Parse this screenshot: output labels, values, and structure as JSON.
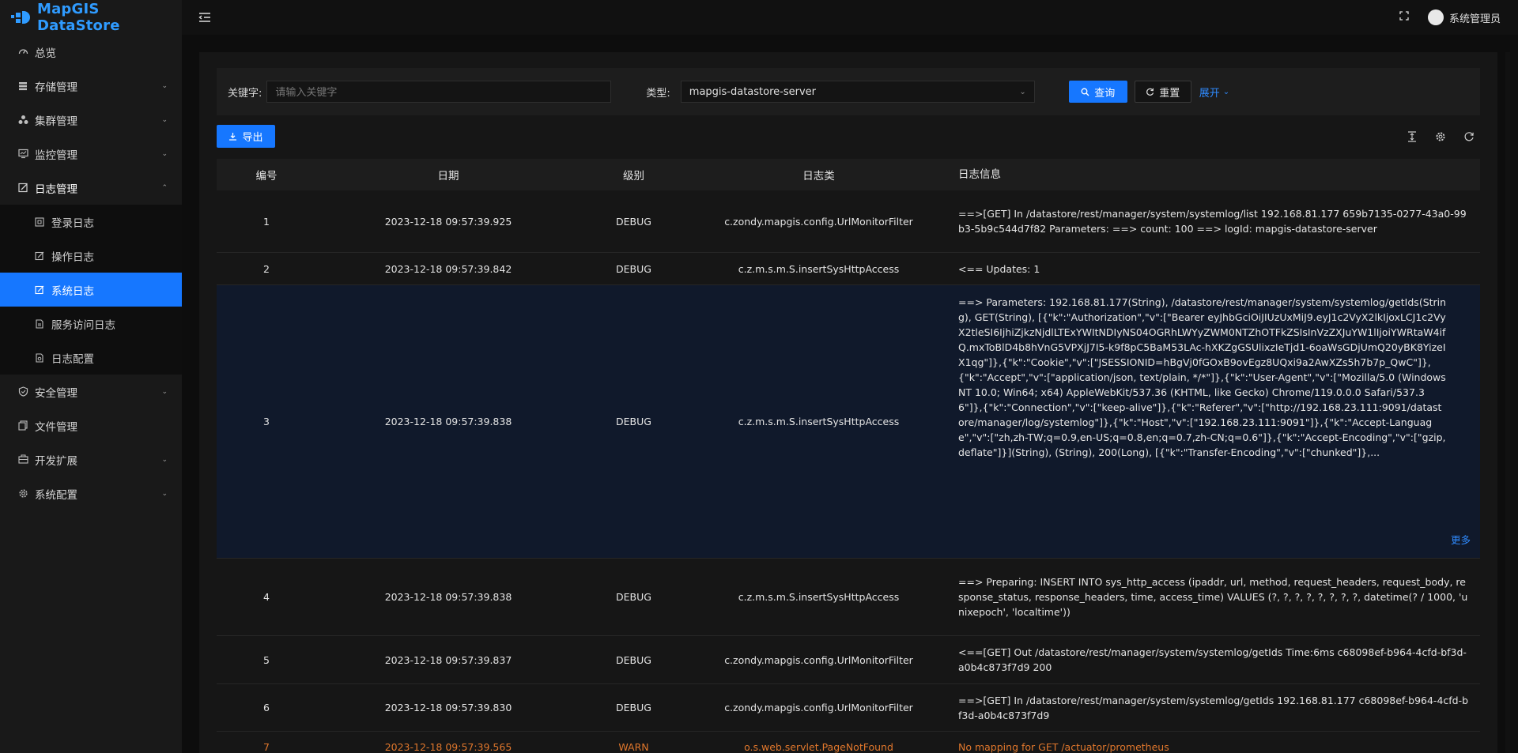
{
  "app": {
    "title": "MapGIS DataStore"
  },
  "colors": {
    "accent": "#1677ff",
    "warn": "#e0772c",
    "sidebar_bg": "#191919"
  },
  "sidebar": {
    "items": [
      {
        "label": "总览",
        "icon": "dashboard-icon",
        "has_chevron": false
      },
      {
        "label": "存储管理",
        "icon": "database-icon",
        "has_chevron": true
      },
      {
        "label": "集群管理",
        "icon": "cluster-icon",
        "has_chevron": true
      },
      {
        "label": "监控管理",
        "icon": "monitor-icon",
        "has_chevron": true
      },
      {
        "label": "日志管理",
        "icon": "log-icon",
        "has_chevron": true,
        "expanded": true,
        "children": [
          {
            "label": "登录日志",
            "icon": "login-log-icon"
          },
          {
            "label": "操作日志",
            "icon": "edit-log-icon"
          },
          {
            "label": "系统日志",
            "icon": "system-log-icon",
            "active": true
          },
          {
            "label": "服务访问日志",
            "icon": "file-icon"
          },
          {
            "label": "日志配置",
            "icon": "config-file-icon"
          }
        ]
      },
      {
        "label": "安全管理",
        "icon": "shield-icon",
        "has_chevron": true
      },
      {
        "label": "文件管理",
        "icon": "copy-icon",
        "has_chevron": false
      },
      {
        "label": "开发扩展",
        "icon": "extension-icon",
        "has_chevron": true
      },
      {
        "label": "系统配置",
        "icon": "gear-icon",
        "has_chevron": true
      }
    ]
  },
  "header": {
    "user": "系统管理员"
  },
  "filter": {
    "keyword_label": "关键字:",
    "keyword_placeholder": "请输入关键字",
    "type_label": "类型:",
    "type_value": "mapgis-datastore-server",
    "search_label": "查询",
    "reset_label": "重置",
    "expand_label": "展开"
  },
  "toolbar": {
    "export_label": "导出"
  },
  "table": {
    "columns": [
      "编号",
      "日期",
      "级别",
      "日志类",
      "日志信息"
    ],
    "more_label": "更多",
    "rows": [
      {
        "id": "1",
        "date": "2023-12-18 09:57:39.925",
        "level": "DEBUG",
        "class": "c.zondy.mapgis.config.UrlMonitorFilter",
        "msg": "==>[GET] In /datastore/rest/manager/system/systemlog/list 192.168.81.177 659b7135-0277-43a0-99b3-5b9c544d7f82 Parameters: ==> count: 100 ==> logId: mapgis-datastore-server"
      },
      {
        "id": "2",
        "date": "2023-12-18 09:57:39.842",
        "level": "DEBUG",
        "class": "c.z.m.s.m.S.insertSysHttpAccess",
        "msg": "<== Updates: 1"
      },
      {
        "id": "3",
        "date": "2023-12-18 09:57:39.838",
        "level": "DEBUG",
        "class": "c.z.m.s.m.S.insertSysHttpAccess",
        "msg": "==> Parameters: 192.168.81.177(String), /datastore/rest/manager/system/systemlog/getIds(String), GET(String), [{\"k\":\"Authorization\",\"v\":[\"Bearer eyJhbGciOiJIUzUxMiJ9.eyJ1c2VyX2lkIjoxLCJ1c2VyX2tleSI6IjhiZjkzNjdlLTExYWItNDIyNS04OGRhLWYyZWM0NTZhOTFkZSIsInVzZXJuYW1lIjoiYWRtaW4ifQ.mxToBlD4b8hVnG5VPXjJ7I5-k9f8pC5BaM53LAc-hXKZgGSUlixzIeTjd1-6oaWsGDjUmQ20yBK8YizeIX1qg\"]},{\"k\":\"Cookie\",\"v\":[\"JSESSIONID=hBgVj0fGOxB9ovEgz8UQxi9a2AwXZs5h7b7p_QwC\"]},{\"k\":\"Accept\",\"v\":[\"application/json, text/plain, */*\"]},{\"k\":\"User-Agent\",\"v\":[\"Mozilla/5.0 (Windows NT 10.0; Win64; x64) AppleWebKit/537.36 (KHTML, like Gecko) Chrome/119.0.0.0 Safari/537.36\"]},{\"k\":\"Connection\",\"v\":[\"keep-alive\"]},{\"k\":\"Referer\",\"v\":[\"http://192.168.23.111:9091/datastore/manager/log/systemlog\"]},{\"k\":\"Host\",\"v\":[\"192.168.23.111:9091\"]},{\"k\":\"Accept-Language\",\"v\":[\"zh,zh-TW;q=0.9,en-US;q=0.8,en;q=0.7,zh-CN;q=0.6\"]},{\"k\":\"Accept-Encoding\",\"v\":[\"gzip, deflate\"]}](String), (String), 200(Long), [{\"k\":\"Transfer-Encoding\",\"v\":[\"chunked\"]},..."
      },
      {
        "id": "4",
        "date": "2023-12-18 09:57:39.838",
        "level": "DEBUG",
        "class": "c.z.m.s.m.S.insertSysHttpAccess",
        "msg": "==> Preparing: INSERT INTO sys_http_access (ipaddr, url, method, request_headers, request_body, response_status, response_headers, time, access_time) VALUES (?, ?, ?, ?, ?, ?, ?, ?, datetime(? / 1000, 'unixepoch', 'localtime'))"
      },
      {
        "id": "5",
        "date": "2023-12-18 09:57:39.837",
        "level": "DEBUG",
        "class": "c.zondy.mapgis.config.UrlMonitorFilter",
        "msg": "<==[GET] Out /datastore/rest/manager/system/systemlog/getIds Time:6ms c68098ef-b964-4cfd-bf3d-a0b4c873f7d9 200"
      },
      {
        "id": "6",
        "date": "2023-12-18 09:57:39.830",
        "level": "DEBUG",
        "class": "c.zondy.mapgis.config.UrlMonitorFilter",
        "msg": "==>[GET] In /datastore/rest/manager/system/systemlog/getIds 192.168.81.177 c68098ef-b964-4cfd-bf3d-a0b4c873f7d9"
      },
      {
        "id": "7",
        "date": "2023-12-18 09:57:39.565",
        "level": "WARN",
        "class": "o.s.web.servlet.PageNotFound",
        "msg": "No mapping for GET /actuator/prometheus"
      }
    ]
  }
}
